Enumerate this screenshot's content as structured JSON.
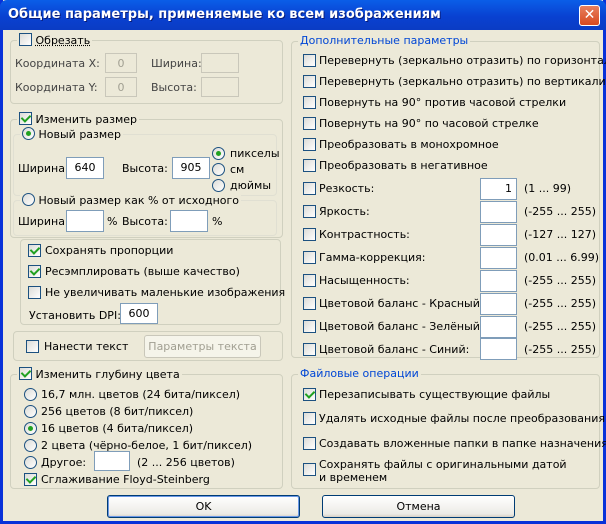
{
  "window": {
    "title": "Общие параметры, применяемые ко всем изображениям"
  },
  "crop": {
    "label": "Обрезать",
    "checked": false,
    "coord_x_label": "Координата X:",
    "coord_x_value": "0",
    "coord_y_label": "Координата Y:",
    "coord_y_value": "0",
    "width_label": "Ширина:",
    "height_label": "Высота:"
  },
  "resize": {
    "label": "Изменить размер",
    "new_size_label": "Новый размер",
    "width_label": "Ширина:",
    "width_value": "640",
    "height_label": "Высота:",
    "height_value": "905",
    "units": [
      "пикселы",
      "см",
      "дюймы"
    ],
    "percent_label": "Новый размер как % от исходного",
    "pct_width_label": "Ширина:",
    "pct_height_label": "Высота:",
    "percent_sign": "%"
  },
  "proportions": {
    "keep_label": "Сохранять пропорции",
    "resample_label": "Ресэмплировать (выше качество)",
    "no_enlarge_label": "Не увеличивать маленькие изображения",
    "dpi_label": "Установить DPI:",
    "dpi_value": "600"
  },
  "text_overlay": {
    "label": "Нанести текст",
    "button_label": "Параметры текста"
  },
  "color_depth": {
    "label": "Изменить глубину цвета",
    "options": [
      "16,7 млн. цветов (24 бита/пиксел)",
      "256 цветов (8 бит/пиксел)",
      "16 цветов (4 бита/пиксел)",
      "2 цвета (чёрно-белое, 1 бит/пиксел)",
      "Другое:"
    ],
    "other_range": "(2 ... 256 цветов)",
    "dither_label": "Сглаживание Floyd-Steinberg"
  },
  "extra": {
    "legend": "Дополнительные параметры",
    "flip_h": "Перевернуть (зеркально отразить) по горизонтали",
    "flip_v": "Перевернуть (зеркально отразить) по вертикали",
    "rot_ccw": "Повернуть на 90° против часовой стрелки",
    "rot_cw": "Повернуть на 90° по часовой стрелке",
    "mono": "Преобразовать в монохромное",
    "negative": "Преобразовать в негативное",
    "adjustments": [
      {
        "label": "Резкость:",
        "value": "1",
        "range": "(1 ... 99)"
      },
      {
        "label": "Яркость:",
        "value": "",
        "range": "(-255 ... 255)"
      },
      {
        "label": "Контрастность:",
        "value": "",
        "range": "(-127 ... 127)"
      },
      {
        "label": "Гамма-коррекция:",
        "value": "",
        "range": "(0.01 ... 6.99)"
      },
      {
        "label": "Насыщенность:",
        "value": "",
        "range": "(-255 ... 255)"
      },
      {
        "label": "Цветовой баланс - Красный:",
        "value": "",
        "range": "(-255 ... 255)"
      },
      {
        "label": "Цветовой баланс - Зелёный:",
        "value": "",
        "range": "(-255 ... 255)"
      },
      {
        "label": "Цветовой баланс - Синий:",
        "value": "",
        "range": "(-255 ... 255)"
      }
    ]
  },
  "file_ops": {
    "legend": "Файловые операции",
    "overwrite": "Перезаписывать существующие файлы",
    "delete_src": "Удалять исходные файлы после преобразования",
    "subfolders": "Создавать вложенные папки в папке назначения",
    "keep_dates": "Сохранять файлы с оригинальными датой и временем"
  },
  "buttons": {
    "ok": "OK",
    "cancel": "Отмена"
  },
  "colors": {
    "title_bar": "#0a5ee8",
    "group_legend": "#0046d5",
    "check": "#21a121"
  }
}
